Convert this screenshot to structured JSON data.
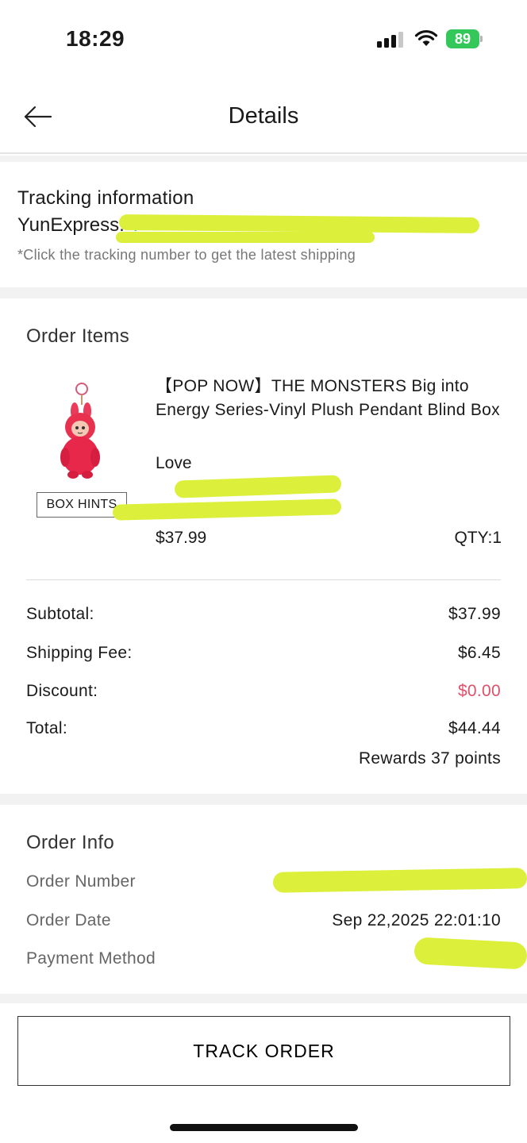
{
  "status_bar": {
    "time": "18:29",
    "battery": "89"
  },
  "header": {
    "title": "Details"
  },
  "tracking": {
    "title": "Tracking information",
    "carrier_label": "YunExpress:",
    "hint": "*Click the tracking number to get the latest shipping"
  },
  "order_items": {
    "title": "Order Items",
    "item": {
      "name": "【POP NOW】THE MONSTERS Big into Energy Series-Vinyl Plush Pendant Blind Box",
      "variant": "Love",
      "badge": "BOX HINTS",
      "price": "$37.99",
      "qty": "QTY:1"
    },
    "summary": [
      {
        "label": "Subtotal:",
        "value": "$37.99"
      },
      {
        "label": "Shipping Fee:",
        "value": "$6.45"
      },
      {
        "label": "Discount:",
        "value": "$0.00"
      },
      {
        "label": "Total:",
        "value": "$44.44"
      }
    ],
    "rewards": "Rewards 37 points"
  },
  "order_info": {
    "title": "Order Info",
    "rows": [
      {
        "label": "Order Number",
        "value": ""
      },
      {
        "label": "Order Date",
        "value": "Sep 22,2025 22:01:10"
      },
      {
        "label": "Payment Method",
        "value": ""
      }
    ]
  },
  "footer": {
    "track_button": "TRACK ORDER"
  },
  "colors": {
    "tracking_link": "#1fb6d1",
    "discount": "#e0506a",
    "redaction": "#dcef3a",
    "battery": "#34c759"
  },
  "icons": {
    "back": "arrow-left-icon",
    "signal": "cellular-signal-icon",
    "wifi": "wifi-icon",
    "battery": "battery-charging-icon"
  }
}
